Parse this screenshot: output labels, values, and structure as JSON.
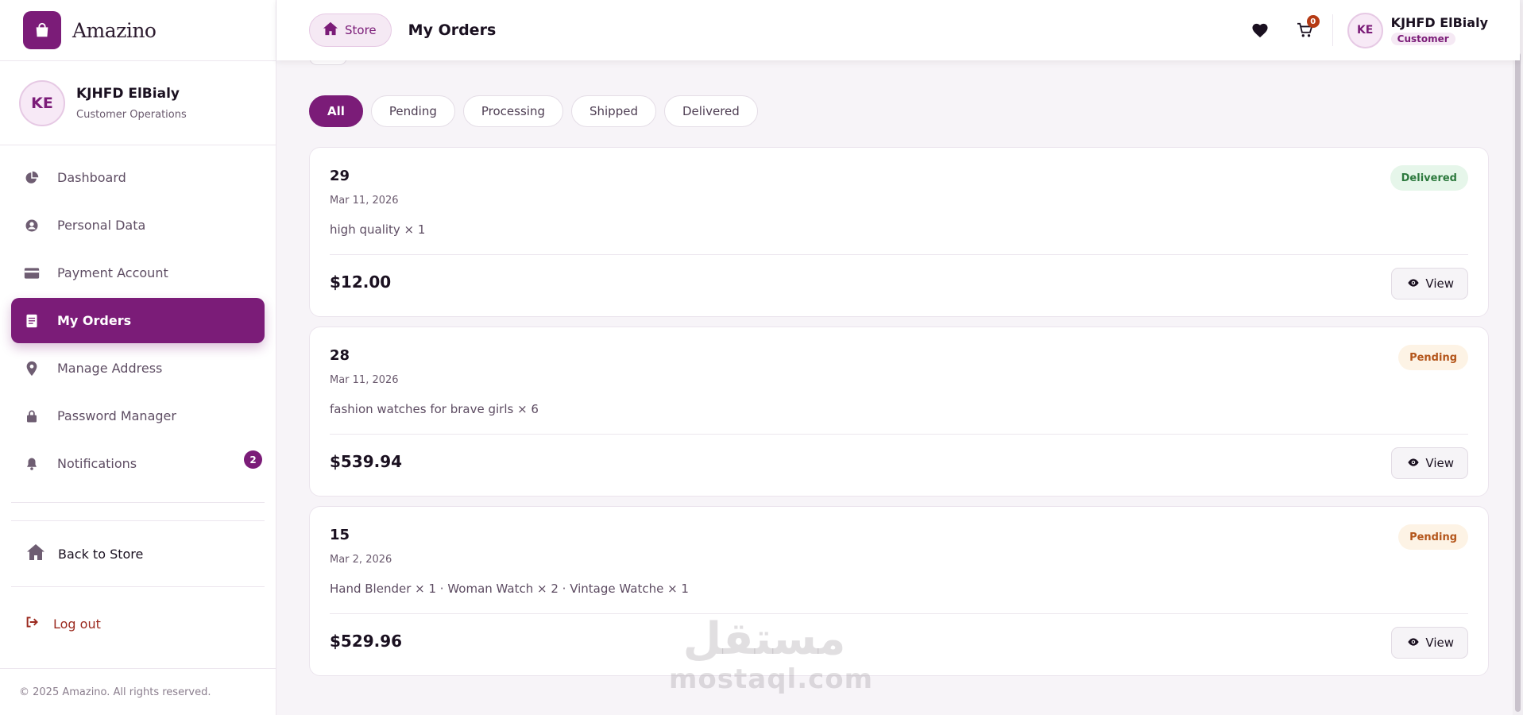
{
  "brand": {
    "name": "Amazino"
  },
  "profile": {
    "initials": "KE",
    "name": "KJHFD ElBialy",
    "role": "Customer Operations"
  },
  "nav": {
    "items": [
      {
        "label": "Dashboard",
        "icon": "pie-chart-icon"
      },
      {
        "label": "Personal Data",
        "icon": "user-circle-icon"
      },
      {
        "label": "Payment Account",
        "icon": "credit-card-icon"
      },
      {
        "label": "My Orders",
        "icon": "receipt-icon",
        "active": true
      },
      {
        "label": "Manage Address",
        "icon": "map-pin-icon"
      },
      {
        "label": "Password Manager",
        "icon": "lock-icon"
      },
      {
        "label": "Notifications",
        "icon": "bell-icon",
        "badge": "2"
      }
    ],
    "back_to_store": "Back to Store",
    "logout": "Log out"
  },
  "footer": {
    "copyright": "© 2025 Amazino. All rights reserved."
  },
  "header": {
    "store_chip": "Store",
    "title": "My Orders",
    "cart_count": "0",
    "user_initials": "KE",
    "user_name": "KJHFD ElBialy",
    "user_role": "Customer"
  },
  "filters": [
    "All",
    "Pending",
    "Processing",
    "Shipped",
    "Delivered"
  ],
  "active_filter": "All",
  "orders": [
    {
      "id": "29",
      "date": "Mar 11, 2026",
      "items": "high quality × 1",
      "total": "$12.00",
      "status": "Delivered",
      "action": "View"
    },
    {
      "id": "28",
      "date": "Mar 11, 2026",
      "items": "fashion watches for brave girls × 6",
      "total": "$539.94",
      "status": "Pending",
      "action": "View"
    },
    {
      "id": "15",
      "date": "Mar 2, 2026",
      "items": "Hand Blender × 1 · Woman Watch × 2 · Vintage Watche × 1",
      "total": "$529.96",
      "status": "Pending",
      "action": "View"
    }
  ],
  "watermark": {
    "arabic": "مستقل",
    "latin": "mostaql.com"
  },
  "colors": {
    "accent": "#7b1c78",
    "delivered": "#2d7a3e",
    "pending": "#b4561b",
    "logout": "#9b2a1f"
  }
}
